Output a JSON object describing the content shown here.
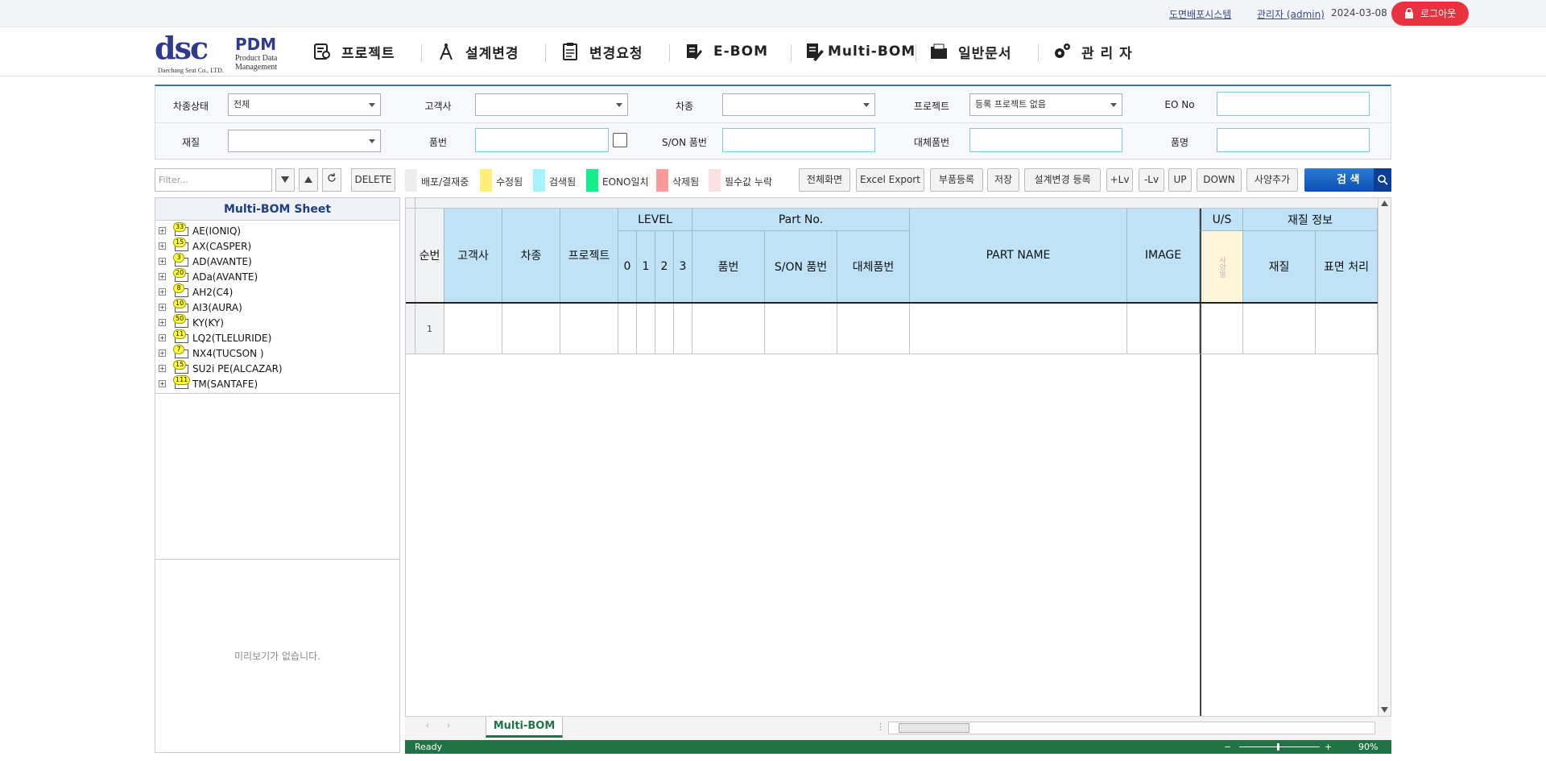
{
  "topbar": {
    "link_system": "도면배포시스템",
    "link_user": "관리자 (admin)",
    "date": "2024-03-08",
    "logout": "로그아웃"
  },
  "logo": {
    "mark": "dsc",
    "pdm": "PDM",
    "sub": "Product Data Management",
    "corp": "Daechang Seat Co., LTD."
  },
  "nav": [
    {
      "label": "프로젝트",
      "icon": "project-icon"
    },
    {
      "label": "설계변경",
      "icon": "compass-icon"
    },
    {
      "label": "변경요청",
      "icon": "clipboard-icon"
    },
    {
      "label": "E-BOM",
      "icon": "ebom-icon"
    },
    {
      "label": "Multi-BOM",
      "icon": "multibom-icon"
    },
    {
      "label": "일반문서",
      "icon": "folder-icon"
    },
    {
      "label": "관 리 자",
      "icon": "gears-icon"
    }
  ],
  "search": {
    "car_status_label": "차종상태",
    "car_status_value": "전체",
    "customer_label": "고객사",
    "customer_value": "",
    "car_type_label": "차종",
    "car_type_value": "",
    "project_label": "프로젝트",
    "project_value": "등록 프로젝트 없음",
    "eo_label": "EO No",
    "material_label": "재질",
    "material_value": "",
    "part_no_label": "품번",
    "son_label": "S/ON 품번",
    "alt_label": "대체품번",
    "part_name_label": "품명"
  },
  "toolbar": {
    "filter_placeholder": "Filter...",
    "delete": "DELETE",
    "legend": [
      {
        "label": "배포/결재중",
        "color": "#ececec"
      },
      {
        "label": "수정됨",
        "color": "#ffee77"
      },
      {
        "label": "검색됨",
        "color": "#a6f4fb"
      },
      {
        "label": "EONO일치",
        "color": "#16ee8e"
      },
      {
        "label": "삭제됨",
        "color": "#fc9a9a"
      },
      {
        "label": "필수값 누락",
        "color": "#fde0e0"
      }
    ],
    "buttons": [
      "전체화면",
      "Excel Export",
      "부품등록",
      "저장",
      "설계변경 등록",
      "+Lv",
      "-Lv",
      "UP",
      "DOWN",
      "사양추가"
    ],
    "search": "검 색"
  },
  "left": {
    "title": "Multi-BOM Sheet",
    "tree": [
      {
        "name": "AE(IONIQ)",
        "count": "33"
      },
      {
        "name": "AX(CASPER)",
        "count": "15"
      },
      {
        "name": "AD(AVANTE)",
        "count": "3"
      },
      {
        "name": "ADa(AVANTE)",
        "count": "20"
      },
      {
        "name": "AH2(C4)",
        "count": "8"
      },
      {
        "name": "AI3(AURA)",
        "count": "10"
      },
      {
        "name": "KY(KY)",
        "count": "50"
      },
      {
        "name": "LQ2(TLELURIDE)",
        "count": "11"
      },
      {
        "name": "NX4(TUCSON )",
        "count": "7"
      },
      {
        "name": "SU2i PE(ALCAZAR)",
        "count": "15"
      },
      {
        "name": "TM(SANTAFE)",
        "count": "111"
      }
    ],
    "preview": "미리보기가 없습니다."
  },
  "grid": {
    "headers": {
      "seq": "순번",
      "customer": "고객사",
      "car": "차종",
      "project": "프로젝트",
      "level": "LEVEL",
      "l0": "0",
      "l1": "1",
      "l2": "2",
      "l3": "3",
      "partno": "Part No.",
      "pn": "품번",
      "son": "S/ON 품번",
      "alt": "대체품번",
      "partname": "PART NAME",
      "image": "IMAGE",
      "us": "U/S",
      "us_sub": "사양별",
      "matinfo": "재질 정보",
      "mat": "재질",
      "surface": "표면 처리"
    },
    "rows": [
      "1"
    ],
    "sheet_tab": "Multi-BOM",
    "status": "Ready",
    "zoom": "90%"
  }
}
